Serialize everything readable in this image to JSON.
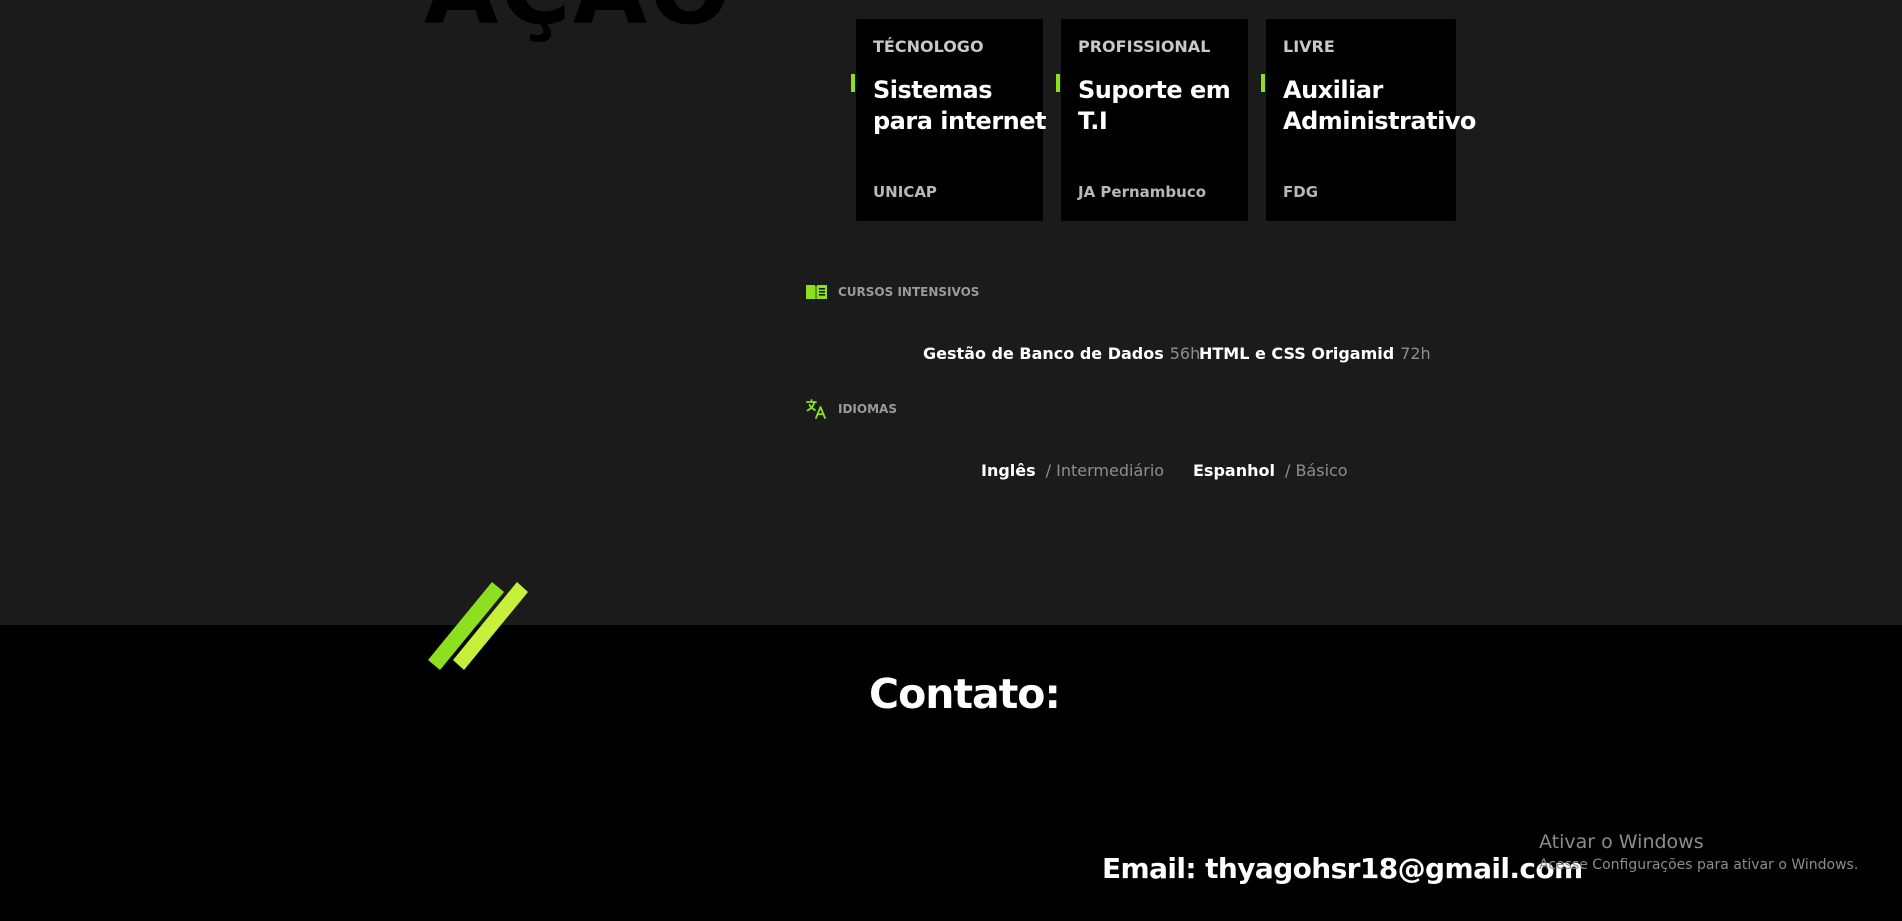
{
  "background_heading": "AÇÃO",
  "cards": [
    {
      "type": "TÉCNOLOGO",
      "title": "Sistemas para internet",
      "institution": "UNICAP"
    },
    {
      "type": "PROFISSIONAL",
      "title": "Suporte em T.I",
      "institution": "JA Pernambuco"
    },
    {
      "type": "LIVRE",
      "title": "Auxiliar Administrativo",
      "institution": "FDG"
    }
  ],
  "courses": {
    "label": "CURSOS INTENSIVOS",
    "icon": "book-icon",
    "items": [
      {
        "name": "Gestão de Banco de Dados",
        "hours": "56h"
      },
      {
        "name": "HTML e CSS Origamid",
        "hours": "72h"
      }
    ]
  },
  "languages": {
    "label": "IDIOMAS",
    "icon": "translate-icon",
    "items": [
      {
        "name": "Inglês",
        "level": "/ Intermediário"
      },
      {
        "name": "Espanhol",
        "level": "/ Básico"
      }
    ]
  },
  "contact": {
    "title": "Contato:",
    "email": "Email: thyagohsr18@gmail.com"
  },
  "windows_watermark": {
    "title": "Ativar o Windows",
    "subtitle": "Acesse Configurações para ativar o Windows."
  },
  "colors": {
    "accent": "#8ce020",
    "accent_light": "#c6f03a",
    "upper_bg": "#1b1b1b",
    "lower_bg": "#000000"
  }
}
